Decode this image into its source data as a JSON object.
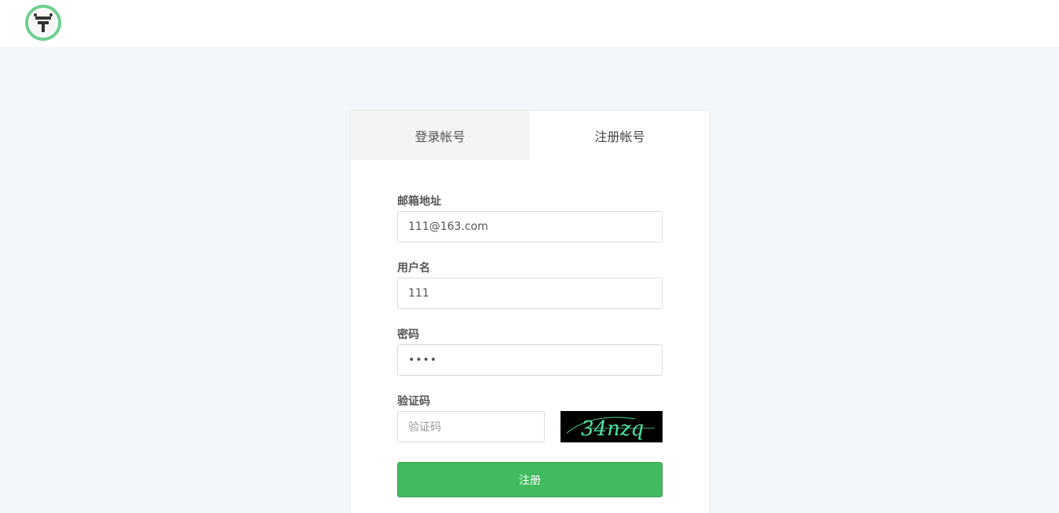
{
  "header": {
    "logo_icon": "badge-logo-icon"
  },
  "tabs": [
    {
      "label": "登录帐号",
      "active": false
    },
    {
      "label": "注册帐号",
      "active": true
    }
  ],
  "form": {
    "email": {
      "label": "邮箱地址",
      "value": "111@163.com"
    },
    "username": {
      "label": "用户名",
      "value": "111"
    },
    "password": {
      "label": "密码",
      "masked": "••••"
    },
    "captcha": {
      "label": "验证码",
      "placeholder": "验证码",
      "image_text": "34nzq"
    },
    "submit_label": "注册"
  },
  "colors": {
    "page_bg": "#f3f7fa",
    "accent": "#41bb5e",
    "captcha_text": "#4fe4a0"
  }
}
